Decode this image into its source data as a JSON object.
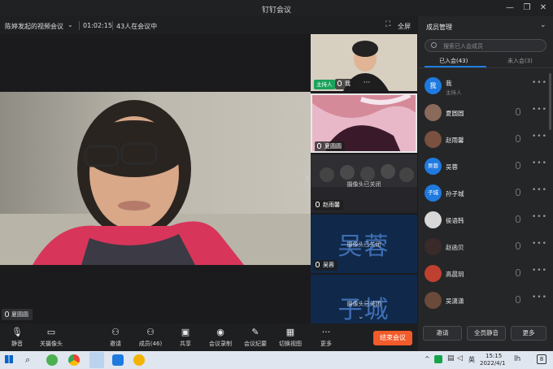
{
  "window": {
    "title": "钉钉会议"
  },
  "meeting": {
    "name": "陈婷发起的视频会议",
    "elapsed": "01:02:15",
    "participants_text": "43人在会议中",
    "fullscreen_label": "全屏"
  },
  "main_video": {
    "speaker_name": "夏圆圆"
  },
  "thumbnails": [
    {
      "name": "我",
      "badge": "主持人",
      "camera_off": ""
    },
    {
      "name": "夏圆圆",
      "camera_off": ""
    },
    {
      "name": "赵雨馨",
      "camera_off": "摄像头已关闭"
    },
    {
      "name": "吴蓉",
      "camera_off": "摄像头已关闭",
      "big_label": "吴蓉"
    },
    {
      "name": "",
      "camera_off": "摄像头已关闭",
      "big_label": "子城"
    }
  ],
  "toolbar": {
    "items": [
      "静音",
      "关摄像头",
      "邀请",
      "成员(46)",
      "共享",
      "会议录制",
      "会议纪要",
      "切换视图",
      "更多"
    ],
    "end_label": "结束会议"
  },
  "panel": {
    "title": "成员管理",
    "search_placeholder": "搜索已入会成员",
    "tab_joined": "已入会(43)",
    "tab_not_joined": "未入会(3)",
    "members": [
      {
        "name": "我",
        "role": "主持人",
        "avatar_text": "我",
        "avatar_color": "#1f7ae0"
      },
      {
        "name": "夏圆圆",
        "role": "",
        "avatar_text": "",
        "avatar_color": "#8a6a5a"
      },
      {
        "name": "赵雨馨",
        "role": "",
        "avatar_text": "",
        "avatar_color": "#7a5040"
      },
      {
        "name": "吴蓉",
        "role": "",
        "avatar_text": "吴蓉",
        "avatar_color": "#1f7ae0"
      },
      {
        "name": "孙子城",
        "role": "",
        "avatar_text": "子城",
        "avatar_color": "#1f7ae0"
      },
      {
        "name": "侯语韩",
        "role": "",
        "avatar_text": "",
        "avatar_color": "#d8d8d8"
      },
      {
        "name": "赵函贝",
        "role": "",
        "avatar_text": "",
        "avatar_color": "#3a2a2a"
      },
      {
        "name": "高晨玥",
        "role": "",
        "avatar_text": "",
        "avatar_color": "#c04030"
      },
      {
        "name": "吴潇潇",
        "role": "",
        "avatar_text": "",
        "avatar_color": "#6a4a3a"
      }
    ],
    "buttons": [
      "邀请",
      "全员静音",
      "更多"
    ]
  },
  "taskbar": {
    "time": "15:15",
    "date": "2022/4/1",
    "ime": "英",
    "notify_count": "8"
  },
  "colors": {
    "accent": "#1f7ae0",
    "end_button": "#f25b2a",
    "host_badge": "#19a35b"
  }
}
